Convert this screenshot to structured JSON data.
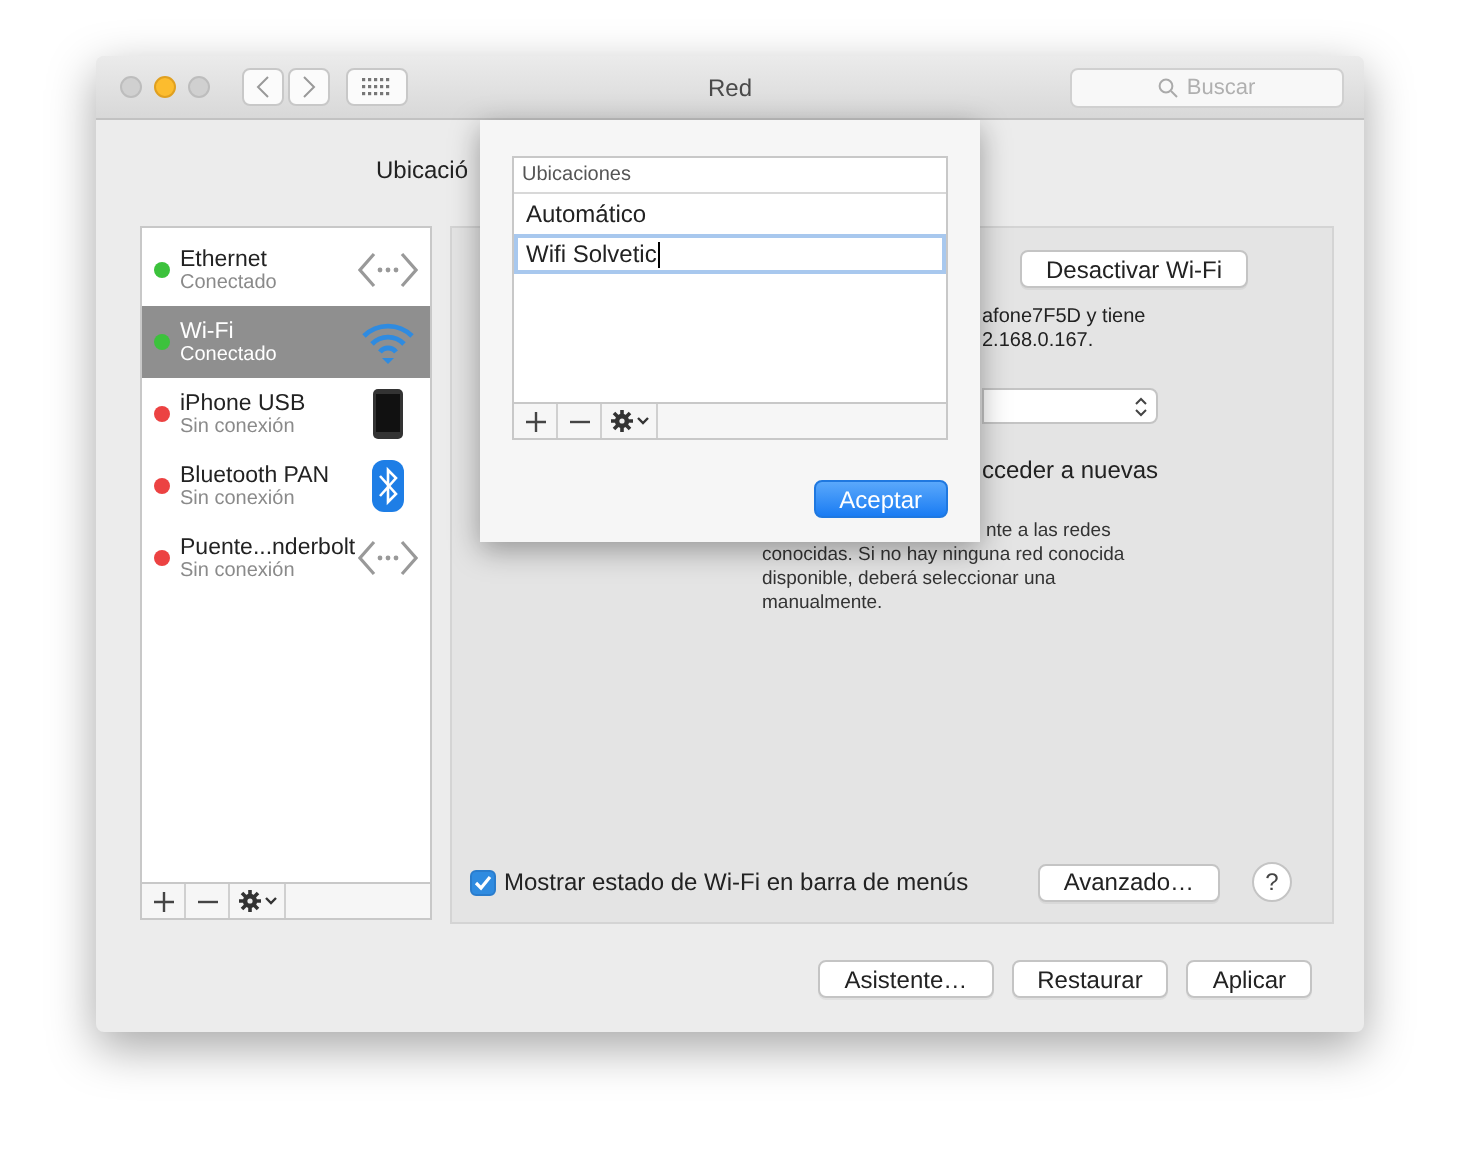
{
  "window": {
    "title": "Red",
    "search_placeholder": "Buscar"
  },
  "location_label": "Ubicació",
  "services": [
    {
      "name": "Ethernet",
      "status": "Conectado",
      "color": "#3cc23c",
      "selected": false,
      "kind": "ethernet"
    },
    {
      "name": "Wi-Fi",
      "status": "Conectado",
      "color": "#3cc23c",
      "selected": true,
      "kind": "wifi"
    },
    {
      "name": "iPhone USB",
      "status": "Sin conexión",
      "color": "#ec4242",
      "selected": false,
      "kind": "phone"
    },
    {
      "name": "Bluetooth PAN",
      "status": "Sin conexión",
      "color": "#ec4242",
      "selected": false,
      "kind": "bluetooth"
    },
    {
      "name": "Puente...nderbolt",
      "status": "Sin conexión",
      "color": "#ec4242",
      "selected": false,
      "kind": "ethernet"
    }
  ],
  "detail": {
    "toggle_button": "Desactivar Wi-Fi",
    "status_lines": [
      "afone7F5D y tiene",
      "2.168.0.167."
    ],
    "option_label": "cceder a nuevas",
    "note_lines": [
      "nte a las redes",
      "conocidas. Si no hay ninguna red conocida",
      "disponible, deberá seleccionar una",
      "manualmente."
    ]
  },
  "show_status": {
    "label": "Mostrar estado de Wi-Fi en barra de menús",
    "checked": true
  },
  "advanced_button": "Avanzado…",
  "help_button": "?",
  "footer_buttons": [
    "Asistente…",
    "Restaurar",
    "Aplicar"
  ],
  "sheet": {
    "column": "Ubicaciones",
    "locations": [
      {
        "name": "Automático",
        "editing": false
      },
      {
        "name": "Wifi Solvetic",
        "editing": true
      }
    ],
    "confirm_button": "Aceptar"
  }
}
